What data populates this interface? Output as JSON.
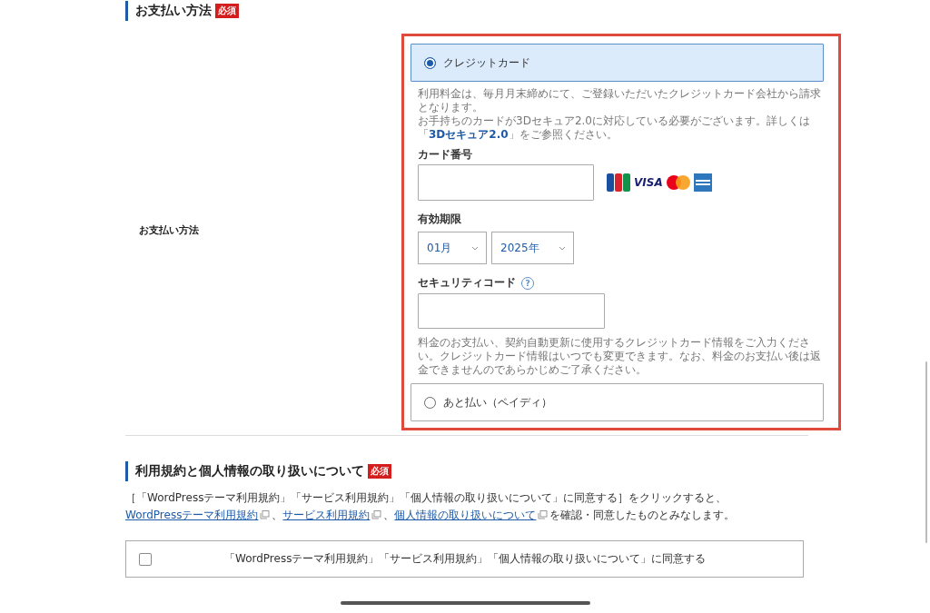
{
  "payment_section": {
    "title": "お支払い方法",
    "required_badge": "必須",
    "field_label": "お支払い方法",
    "options": [
      {
        "kind": "card",
        "label": "クレジットカード",
        "selected": true,
        "billing_note": "利用料金は、毎月月末締めにて、ご登録いただいたクレジットカード会社から請求となります。",
        "secure_note": {
          "before": "お手持ちのカードが3Dセキュア2.0に対応している必要がございます。詳しくは「",
          "link": "3Dセキュア2.0",
          "after": "」をご参照ください。"
        },
        "card_number_label": "カード番号",
        "visa_logo_text": "VISA",
        "expiry_label": "有効期限",
        "month_value": "01月",
        "year_value": "2025年",
        "security_code_label": "セキュリティコード",
        "help_mark": "?",
        "note": "料金のお支払い、契約自動更新に使用するクレジットカード情報をご入力ください。クレジットカード情報はいつでも変更できます。なお、料金のお支払い後は返金できませんのであらかじめご了承ください。"
      },
      {
        "kind": "deferred",
        "label": "あと払い（ペイディ）",
        "selected": false
      }
    ]
  },
  "terms_section": {
    "title": "利用規約と個人情報の取り扱いについて",
    "required_badge": "必須",
    "intro": "［「WordPressテーマ利用規約」「サービス利用規約」「個人情報の取り扱いについて」に同意する］をクリックすると、",
    "links": [
      {
        "text": "WordPressテーマ利用規約",
        "after": "、"
      },
      {
        "text": "サービス利用規約",
        "after": "、"
      },
      {
        "text": "個人情報の取り扱いについて",
        "after": "を確認・同意したものとみなします。"
      }
    ],
    "agreement": {
      "label": "「WordPressテーマ利用規約」「サービス利用規約」「個人情報の取り扱いについて」に同意する",
      "checked": false
    }
  }
}
